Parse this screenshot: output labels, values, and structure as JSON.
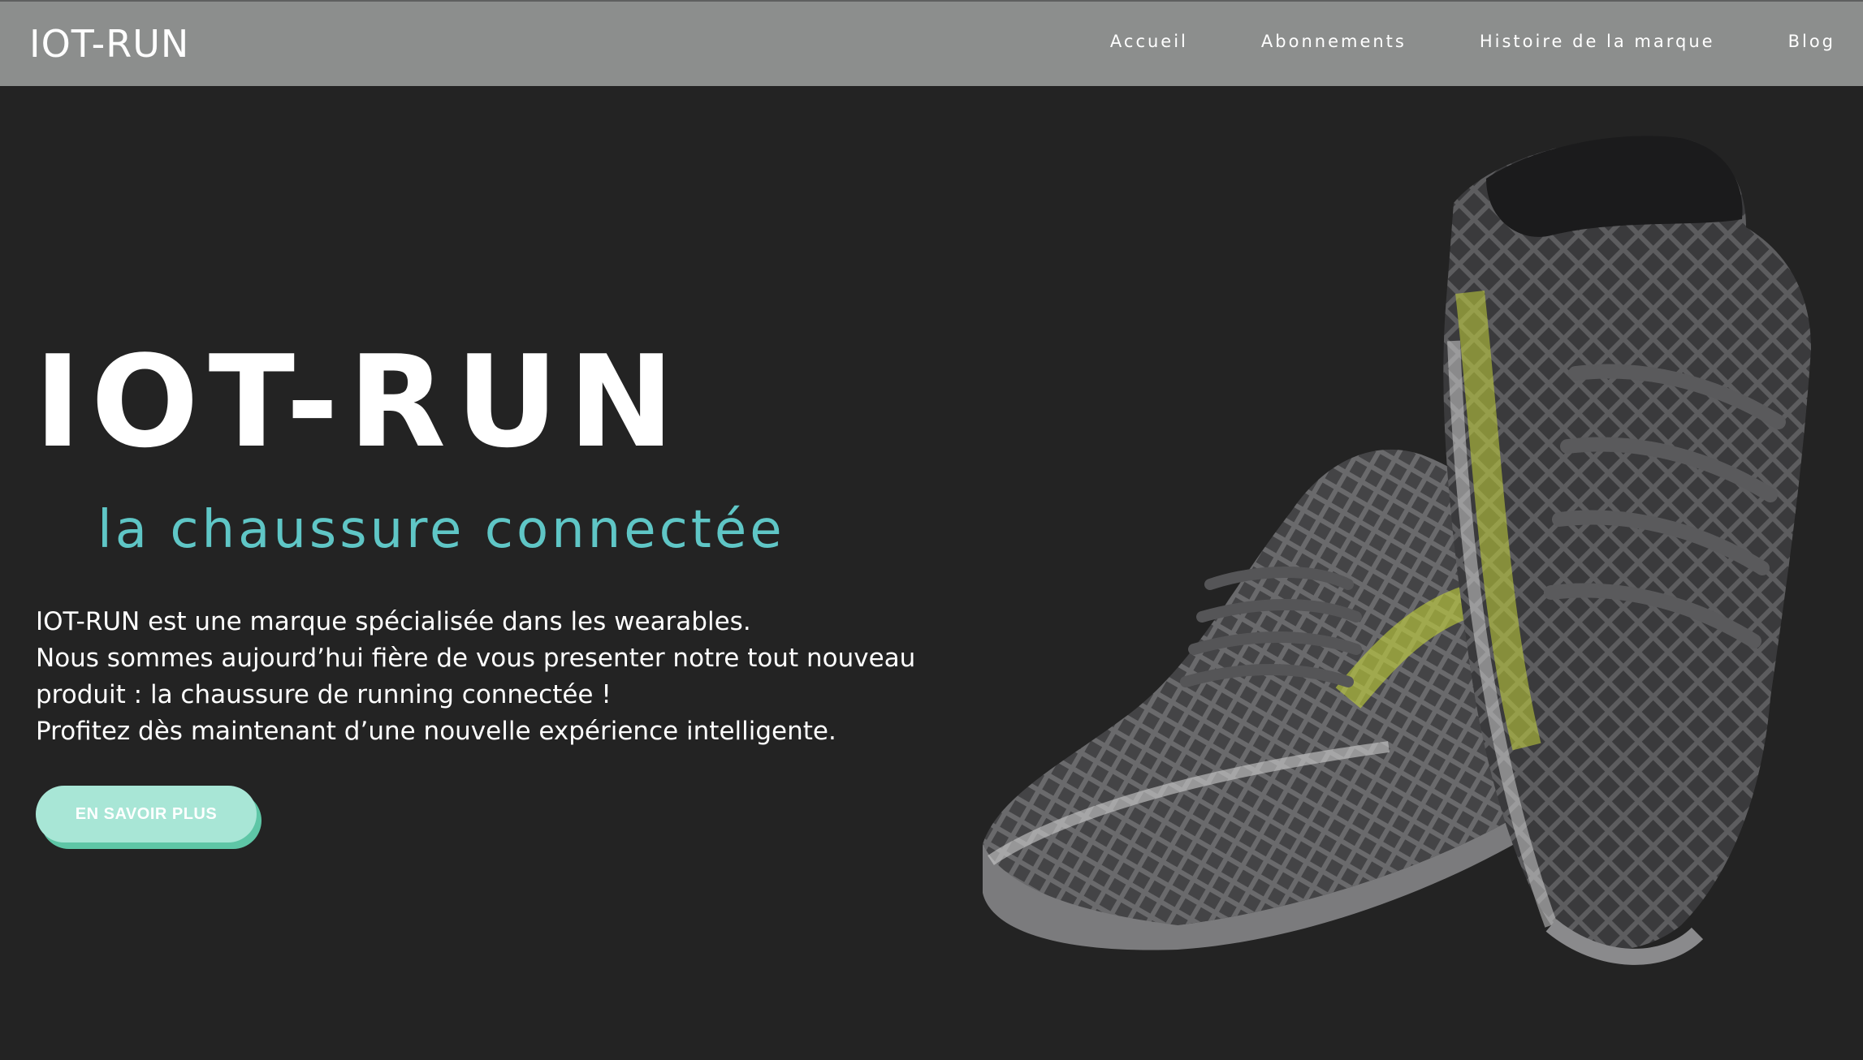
{
  "header": {
    "logo": "IOT-RUN",
    "nav": [
      {
        "label": "Accueil"
      },
      {
        "label": "Abonnements"
      },
      {
        "label": "Histoire de la marque"
      },
      {
        "label": "Blog"
      }
    ]
  },
  "hero": {
    "title": "IOT-RUN",
    "subtitle": "la chaussure connectée",
    "description": [
      "IOT-RUN est une marque spécialisée dans les wearables.",
      "Nous sommes aujourd’hui fière de vous presenter notre tout nouveau",
      "produit : la chaussure de running connectée !",
      "Profitez dès maintenant d’une nouvelle expérience intelligente."
    ],
    "cta_label": "EN SAVOIR PLUS",
    "image": {
      "icon": "running-shoes-image"
    }
  },
  "colors": {
    "background": "#232323",
    "header": "#8c8e8d",
    "accent": "#5fc6c6",
    "button": "#a8e6d6"
  }
}
